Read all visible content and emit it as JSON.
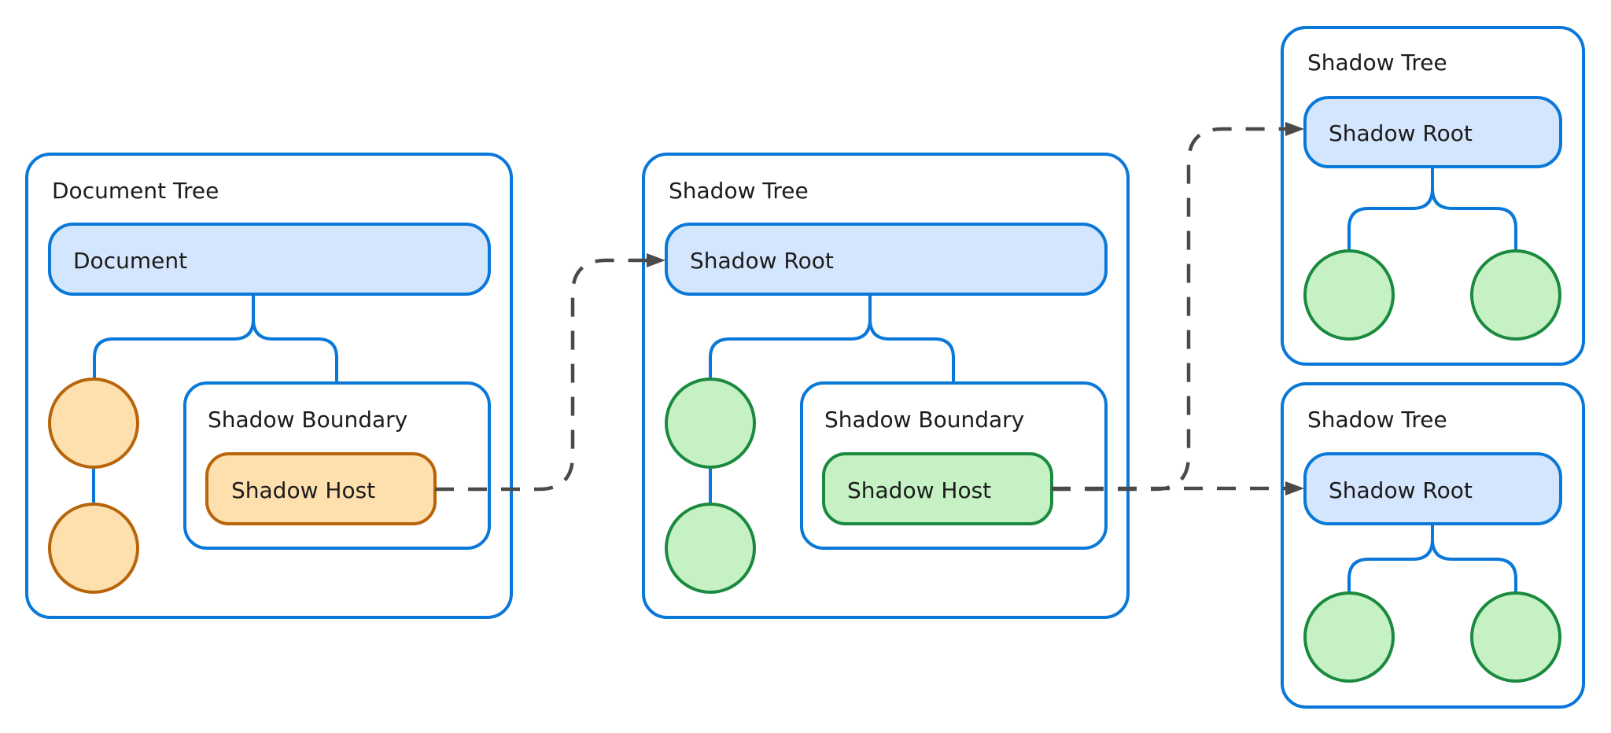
{
  "diagram": {
    "colors": {
      "panel_stroke": "#0a78d8",
      "root_fill": "#d4e6fd",
      "document_node_fill": "#fde0ae",
      "document_node_stroke": "#b8650a",
      "shadow_node_fill": "#c6f1c4",
      "shadow_node_stroke": "#1a8a3e",
      "link_stroke": "#4a4a4a"
    },
    "document_tree": {
      "title": "Document Tree",
      "root_label": "Document",
      "boundary_label": "Shadow Boundary",
      "host_label": "Shadow Host",
      "child_nodes": 2
    },
    "shadow_tree_middle": {
      "title": "Shadow Tree",
      "root_label": "Shadow Root",
      "boundary_label": "Shadow Boundary",
      "host_label": "Shadow Host",
      "child_nodes": 2
    },
    "shadow_tree_top_right": {
      "title": "Shadow Tree",
      "root_label": "Shadow Root",
      "child_nodes": 2
    },
    "shadow_tree_bottom_right": {
      "title": "Shadow Tree",
      "root_label": "Shadow Root",
      "child_nodes": 2
    },
    "links": [
      {
        "from": "Document Tree / Shadow Host",
        "to": "Shadow Tree (middle) / Shadow Root",
        "style": "dashed-arrow"
      },
      {
        "from": "Shadow Tree (middle) / Shadow Host",
        "to": "Shadow Tree (top-right) / Shadow Root",
        "style": "dashed-arrow"
      },
      {
        "from": "Shadow Tree (middle) / Shadow Host",
        "to": "Shadow Tree (bottom-right) / Shadow Root",
        "style": "dashed-arrow"
      }
    ]
  }
}
